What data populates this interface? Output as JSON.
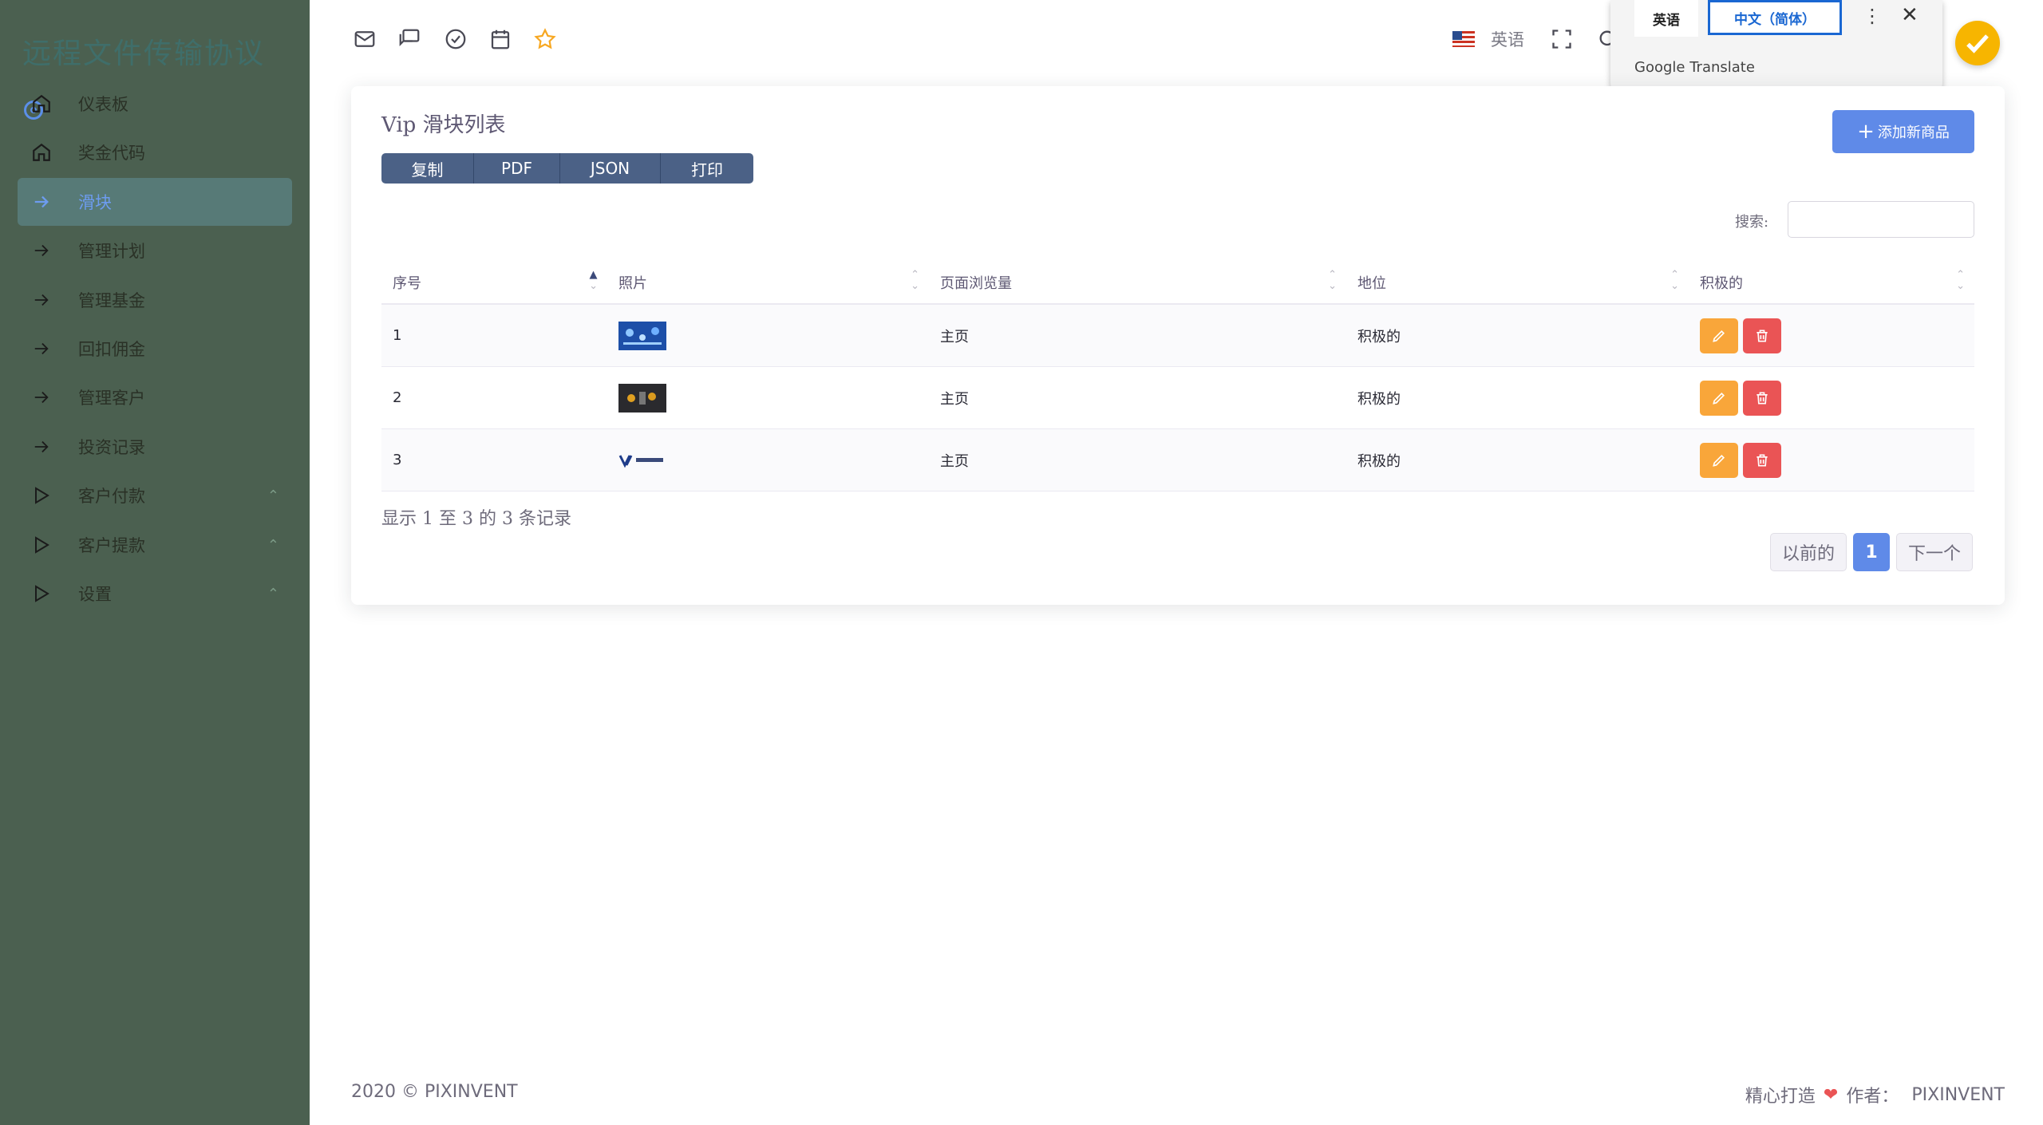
{
  "sidebar": {
    "brand": "远程文件传输协议",
    "items": [
      {
        "label": "仪表板",
        "icon": "home-icon"
      },
      {
        "label": "奖金代码",
        "icon": "home-icon"
      },
      {
        "label": "滑块",
        "icon": "arrow-right-icon",
        "active": true
      },
      {
        "label": "管理计划",
        "icon": "arrow-right-icon"
      },
      {
        "label": "管理基金",
        "icon": "arrow-right-icon"
      },
      {
        "label": "回扣佣金",
        "icon": "arrow-right-icon"
      },
      {
        "label": "管理客户",
        "icon": "arrow-right-icon"
      },
      {
        "label": "投资记录",
        "icon": "arrow-right-icon"
      },
      {
        "label": "客户付款",
        "icon": "play-icon",
        "expandable": true
      },
      {
        "label": "客户提款",
        "icon": "play-icon",
        "expandable": true
      },
      {
        "label": "设置",
        "icon": "play-icon",
        "expandable": true
      }
    ]
  },
  "topbar": {
    "icons": [
      "mail-icon",
      "chat-icon",
      "check-circle-icon",
      "calendar-icon",
      "star-icon"
    ],
    "language": "英语",
    "flag": "us-flag-icon"
  },
  "translate_popup": {
    "source_lang": "英语",
    "target_lang": "中文（简体）",
    "brand": "Google Translate"
  },
  "card": {
    "title": "Vip 滑块列表",
    "export_buttons": [
      "复制",
      "PDF",
      "JSON",
      "打印"
    ],
    "add_button": "添加新商品",
    "search_label": "搜索:",
    "search_value": "",
    "columns": [
      "序号",
      "照片",
      "页面浏览量",
      "地位",
      "积极的"
    ],
    "rows": [
      {
        "no": "1",
        "page": "主页",
        "status": "积极的"
      },
      {
        "no": "2",
        "page": "主页",
        "status": "积极的"
      },
      {
        "no": "3",
        "page": "主页",
        "status": "积极的"
      }
    ],
    "info": "显示 1 至 3 的 3 条记录",
    "pager": {
      "prev": "以前的",
      "current": "1",
      "next": "下一个"
    }
  },
  "footer": {
    "copyright": "2020 © PIXINVENT",
    "made_with": "精心打造",
    "by": "作者：",
    "author": "PIXINVENT"
  },
  "colors": {
    "sidebar_bg": "#4b6050",
    "primary": "#5f8ae8",
    "edit": "#f9a63a",
    "delete": "#ea5455"
  }
}
